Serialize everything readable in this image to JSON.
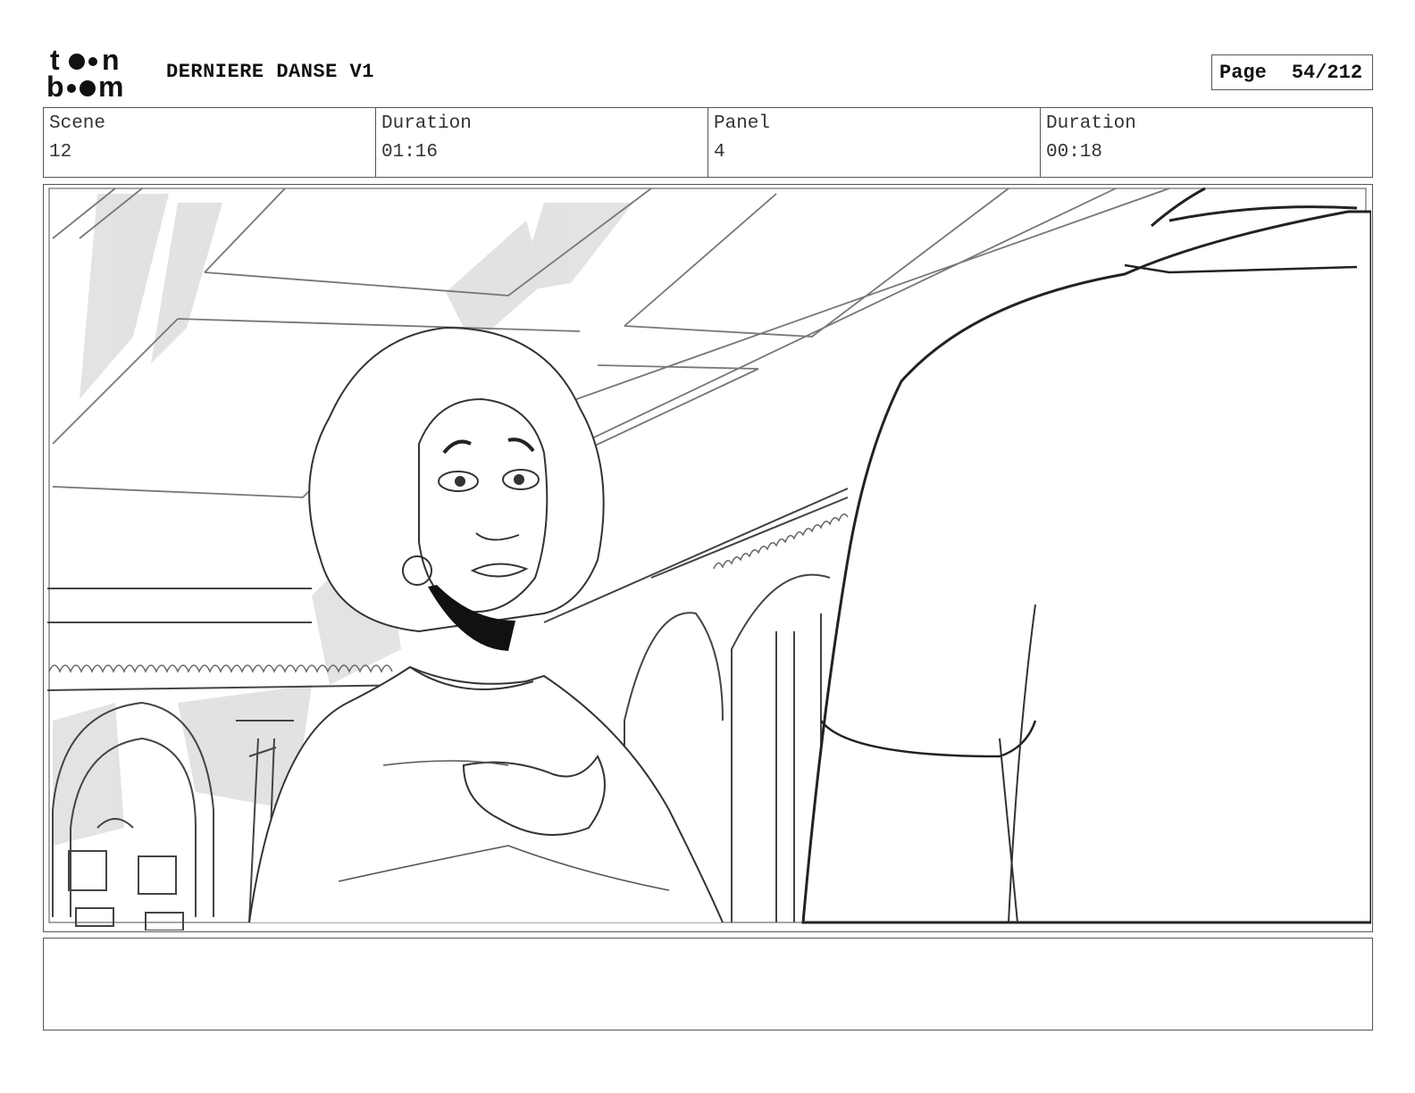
{
  "header": {
    "logo_text": "toon boom",
    "project_title": "DERNIERE DANSE V1",
    "page_label": "Page",
    "page_value": "54/212"
  },
  "info": {
    "scene_label": "Scene",
    "scene_value": "12",
    "scene_duration_label": "Duration",
    "scene_duration_value": "01:16",
    "panel_label": "Panel",
    "panel_value": "4",
    "panel_duration_label": "Duration",
    "panel_duration_value": "00:18"
  },
  "panel": {
    "description": ""
  },
  "notes": {
    "text": ""
  }
}
